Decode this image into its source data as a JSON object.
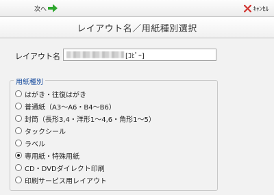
{
  "toolbar": {
    "next_label": "次へ",
    "cancel_label": "ｷｬﾝｾﾙ"
  },
  "dialog": {
    "title": "レイアウト名／用紙種別選択"
  },
  "layout_name": {
    "label": "レイアウト名",
    "value_suffix": "[ｺﾋﾟｰ]"
  },
  "paper_type": {
    "group_label": "用紙種別",
    "options": [
      {
        "label": "はがき・往復はがき",
        "selected": false
      },
      {
        "label": "普通紙（A3～A6・B4～B6）",
        "selected": false
      },
      {
        "label": "封筒（長形3,4・洋形1～4,6・角形1～5）",
        "selected": false
      },
      {
        "label": "タックシール",
        "selected": false
      },
      {
        "label": "ラベル",
        "selected": false
      },
      {
        "label": "専用紙・特殊用紙",
        "selected": true
      },
      {
        "label": "CD・DVDダイレクト印刷",
        "selected": false
      },
      {
        "label": "印刷サービス用レイアウト",
        "selected": false
      }
    ]
  },
  "colors": {
    "next_arrow": "#2ea82e",
    "cancel_x": "#d0312d",
    "group_title": "#1b4fa0"
  }
}
